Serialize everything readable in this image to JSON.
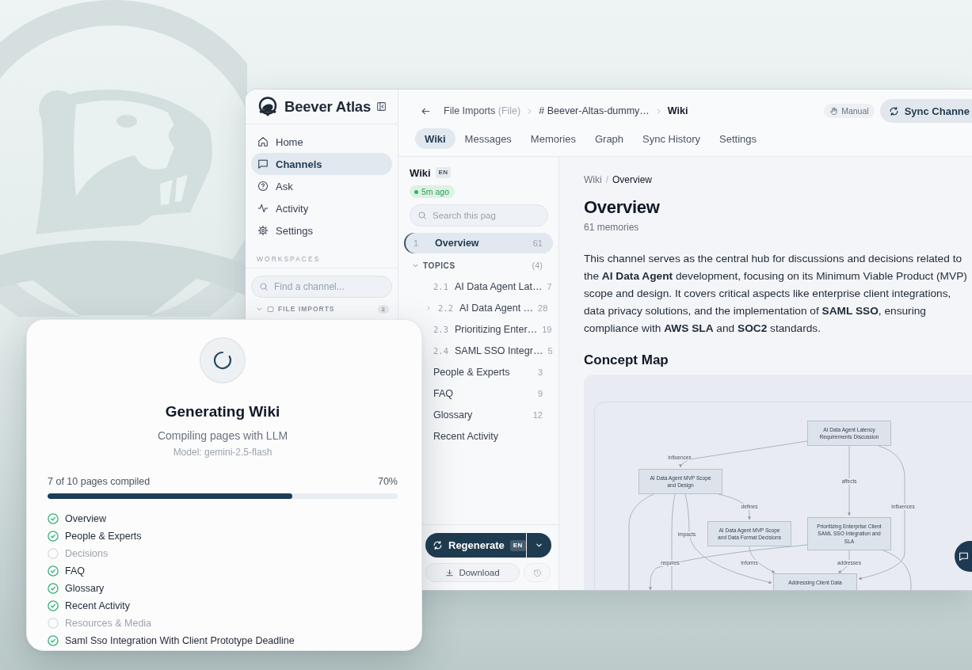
{
  "sidebar": {
    "brand": "Beever Atlas",
    "items": [
      {
        "label": "Home",
        "selected": false
      },
      {
        "label": "Channels",
        "selected": true
      },
      {
        "label": "Ask",
        "selected": false
      },
      {
        "label": "Activity",
        "selected": false
      },
      {
        "label": "Settings",
        "selected": false
      }
    ],
    "section_label": "WORKSPACES",
    "channel_search": {
      "placeholder": "Find a channel..."
    },
    "groups": [
      {
        "label": "FILE IMPORTS",
        "count": "2",
        "expanded": true
      }
    ]
  },
  "topbar": {
    "breadcrumb": [
      {
        "label": "File Imports",
        "suffix": "(File)",
        "current": false
      },
      {
        "label": "# Beever-Altas-dummy…",
        "current": false
      },
      {
        "label": "Wiki",
        "current": true
      }
    ],
    "sync_mode": "Manual",
    "sync_button": "Sync Channe"
  },
  "tabs": [
    {
      "label": "Wiki",
      "selected": true
    },
    {
      "label": "Messages",
      "selected": false
    },
    {
      "label": "Memories",
      "selected": false
    },
    {
      "label": "Graph",
      "selected": false
    },
    {
      "label": "Sync History",
      "selected": false
    },
    {
      "label": "Settings",
      "selected": false
    }
  ],
  "wiki_nav": {
    "title": "Wiki",
    "language": "EN",
    "updated": "5m ago",
    "search_placeholder": "Search this pag",
    "pages": [
      {
        "kind": "page",
        "number": "1",
        "title": "Overview",
        "count": "61",
        "selected": true
      },
      {
        "kind": "section",
        "title": "TOPICS",
        "count": "(4)",
        "expanded": true,
        "children": [
          {
            "number": "2.1",
            "title": "AI Data Agent Lat…",
            "count": "7",
            "expandable": false,
            "selected": false
          },
          {
            "number": "2.2",
            "title": "AI Data Agent …",
            "count": "28",
            "expandable": true,
            "selected": false
          },
          {
            "number": "2.3",
            "title": "Prioritizing Enter…",
            "count": "19",
            "expandable": false,
            "selected": false
          },
          {
            "number": "2.4",
            "title": "SAML SSO Integr…",
            "count": "5",
            "expandable": false,
            "selected": false
          }
        ]
      },
      {
        "kind": "page",
        "title": "People & Experts",
        "count": "3",
        "selected": false
      },
      {
        "kind": "page",
        "title": "FAQ",
        "count": "9",
        "selected": false
      },
      {
        "kind": "page",
        "title": "Glossary",
        "count": "12",
        "selected": false
      },
      {
        "kind": "page",
        "title": "Recent Activity",
        "selected": false
      }
    ],
    "regenerate": {
      "label": "Regenerate",
      "language": "EN"
    },
    "download": "Download"
  },
  "content": {
    "breadcrumb": [
      {
        "label": "Wiki",
        "current": false
      },
      {
        "label": "Overview",
        "current": true
      }
    ],
    "breadcrumb_separator": "/",
    "title": "Overview",
    "subtitle": "61 memories",
    "summary": "This channel serves as the central hub for discussions and decisions related to the **AI Data Agent** development, focusing on its Minimum Viable Product (MVP) scope and design. It covers critical aspects like enterprise client integrations, data privacy solutions, and the implementation of **SAML SSO**, ensuring compliance with **AWS SLA** and **SOC2** standards.",
    "concept_map": {
      "title": "Concept Map",
      "nodes": [
        {
          "label": "AI Data Agent Latency Requirements Discussion"
        },
        {
          "label": "AI Data Agent MVP Scope and Design"
        },
        {
          "label": "AI Data Agent MVP Scope and Data Format Decisions"
        },
        {
          "label": "Prioritizing Enterprise Client SAML SSO Integration and SLA"
        },
        {
          "label": "Addressing Client Data"
        }
      ],
      "edges": [
        {
          "label": "influences"
        },
        {
          "label": "affects"
        },
        {
          "label": "influences"
        },
        {
          "label": "defines"
        },
        {
          "label": "impacts"
        },
        {
          "label": "requires"
        },
        {
          "label": "informs"
        },
        {
          "label": "addresses"
        }
      ]
    }
  },
  "generator": {
    "title": "Generating Wiki",
    "subtitle": "Compiling pages with LLM",
    "model": "Model: gemini-2.5-flash",
    "progress": {
      "label": "7 of 10 pages compiled",
      "percent": "70%",
      "level": 0.7
    },
    "pages": [
      {
        "title": "Overview",
        "done": true
      },
      {
        "title": "People & Experts",
        "done": true
      },
      {
        "title": "Decisions",
        "done": false
      },
      {
        "title": "FAQ",
        "done": true
      },
      {
        "title": "Glossary",
        "done": true
      },
      {
        "title": "Recent Activity",
        "done": true
      },
      {
        "title": "Resources & Media",
        "done": false
      },
      {
        "title": "Saml Sso Integration With Client Prototype Deadline",
        "done": true
      }
    ]
  }
}
